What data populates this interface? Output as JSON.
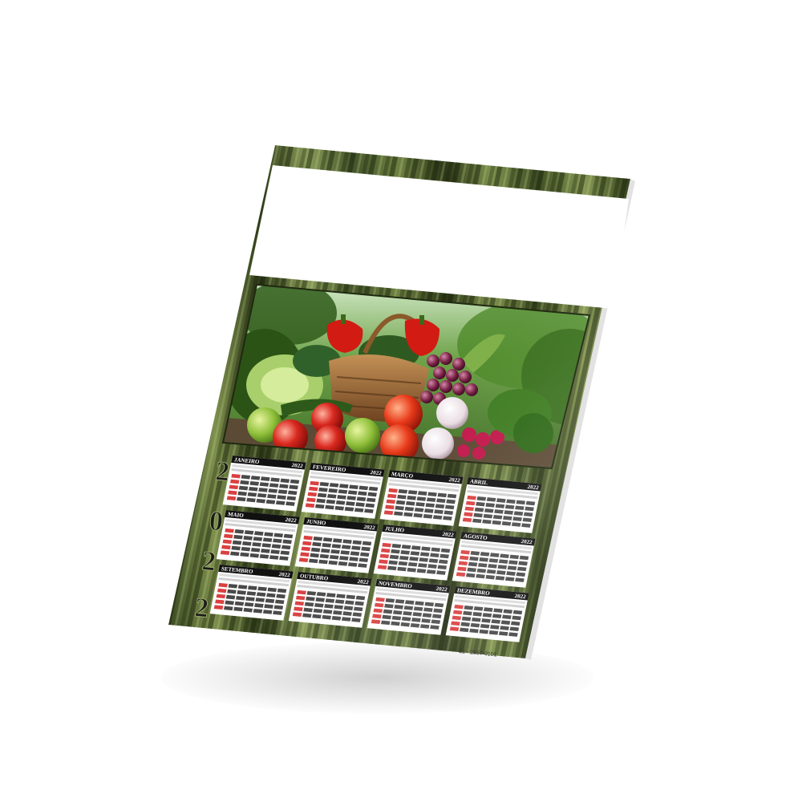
{
  "calendar": {
    "year": "2022",
    "year_digits": [
      "2",
      "0",
      "2",
      "2"
    ],
    "months": [
      {
        "name": "JANEIRO",
        "year": "2022"
      },
      {
        "name": "FEVEREIRO",
        "year": "2022"
      },
      {
        "name": "MARÇO",
        "year": "2022"
      },
      {
        "name": "ABRIL",
        "year": "2022"
      },
      {
        "name": "MAIO",
        "year": "2022"
      },
      {
        "name": "JUNHO",
        "year": "2022"
      },
      {
        "name": "JULHO",
        "year": "2022"
      },
      {
        "name": "AGOSTO",
        "year": "2022"
      },
      {
        "name": "SETEMBRO",
        "year": "2022"
      },
      {
        "name": "OUTUBRO",
        "year": "2022"
      },
      {
        "name": "NOVEMBRO",
        "year": "2022"
      },
      {
        "name": "DEZEMBRO",
        "year": "2022"
      }
    ],
    "footer_code": "31 - 2557-0101"
  },
  "colors": {
    "frame_dark": "#2f3a1c",
    "frame_mid": "#5a6b33",
    "frame_light": "#8a9a5a",
    "header_bar": "#111111",
    "sunday_red": "#d41f1f",
    "photo_bg": "#5b8a3a"
  },
  "photo": {
    "subject": "basket-of-vegetables-and-fruits"
  }
}
